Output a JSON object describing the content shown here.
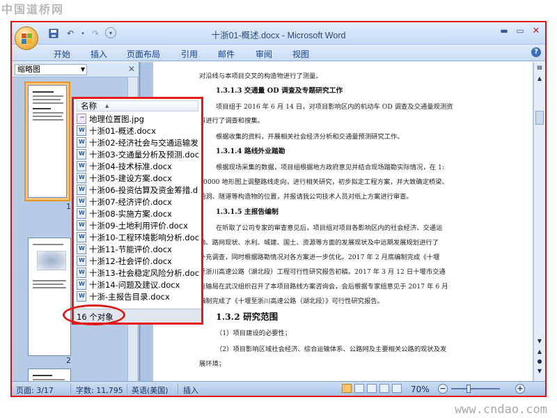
{
  "watermarks": {
    "top": "中国道桥网",
    "bottom": "www.cndao.com"
  },
  "window": {
    "title": "十浙01-概述.docx - Microsoft Word"
  },
  "ribbon": {
    "tabs": [
      "开始",
      "插入",
      "页面布局",
      "引用",
      "邮件",
      "审阅",
      "视图"
    ]
  },
  "nav": {
    "view_select": "缩略图",
    "page_numbers": [
      "1",
      "2"
    ]
  },
  "popup": {
    "column_header": "名称",
    "files": [
      {
        "name": "地理位置图.jpg",
        "type": "image"
      },
      {
        "name": "十浙01-概述.docx",
        "type": "docx"
      },
      {
        "name": "十浙02-经济社会与交通运输发",
        "type": "docx"
      },
      {
        "name": "十浙03-交通量分析及预测.doc",
        "type": "docx"
      },
      {
        "name": "十浙04-技术标准.docx",
        "type": "docx"
      },
      {
        "name": "十浙05-建设方案.docx",
        "type": "docx"
      },
      {
        "name": "十浙06-投资估算及资金筹措.d",
        "type": "docx"
      },
      {
        "name": "十浙07-经济评价.docx",
        "type": "docx"
      },
      {
        "name": "十浙08-实施方案.docx",
        "type": "docx"
      },
      {
        "name": "十浙09-土地利用评价.docx",
        "type": "docx"
      },
      {
        "name": "十浙10-工程环境影响分析.doc",
        "type": "docx"
      },
      {
        "name": "十浙11-节能评价.docx",
        "type": "docx"
      },
      {
        "name": "十浙12-社会评价.docx",
        "type": "docx"
      },
      {
        "name": "十浙13-社会稳定风险分析.doc",
        "type": "docx"
      },
      {
        "name": "十浙14-问题及建议.docx",
        "type": "docx"
      },
      {
        "name": "十浙-主报告目录.docx",
        "type": "docx"
      }
    ],
    "status": "16 个对象"
  },
  "document": {
    "lines": [
      "对沿线与本项目交叉的构造物进行了测量。",
      "1.3.1.3 交通量 OD 调查及专题研究工作",
      "项目组于 2016 年 6 月 14 日，对项目影响区内的机动车 OD 调查及交通量观测资",
      "料进行了调查和搜集。",
      "根据收集的资料，开展相关社会经济分析和交通量预测研究工作。",
      "1.3.1.4 路线外业踏勘",
      "根据现场采集的数据，项目组根据地方政府意见并结合现场踏勘实际情况，在 1:",
      "10000 地形图上调整路线走向，进行相关研究，初步拟定工程方案，并大致确定桥梁、",
      "涵洞、隧道等构造物的位置，并报请我公司技术人员对纸上方案进行审查。",
      "1.3.1.5 主报告编制",
      "在听取了公司专家的审查意见后，项目组对项目各影响区内的社会经济、交通运",
      "输、路网现状、水利、城建、国土、资源等方面的发展现状及中远期发展规划进行了",
      "补充调查，同时根据路勘情况对各方案进一步优化。2017 年 2 月底编制完成《十堰",
      "至浙川高速公路（湖北段）工程可行性研究报告初稿。2017 年 3 月 12 日十堰市交通",
      "运输局在武汉组织召开了本项目路线方案咨询会，会后根据专家组意见于 2017 年 6 月",
      "编制完成了《十堰至浙川高速公路（湖北段）》可行性研究报告。",
      "1.3.2 研究范围",
      "（1）项目建设的必要性；",
      "（2）项目影响区域社会经济、综合运输体系、公路网及主要相关公路的现状及发",
      "展环境；"
    ]
  },
  "status_bar": {
    "page": "页面: 3/17",
    "words": "字数: 11,795",
    "language": "英语(美国)",
    "mode": "插入",
    "zoom": "70%",
    "zoom_value": 0.7
  }
}
